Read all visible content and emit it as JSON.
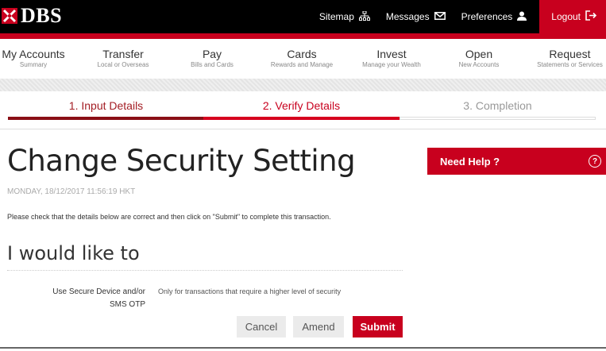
{
  "brand": {
    "name": "DBS",
    "accent": "#c8001e"
  },
  "header": {
    "links": [
      {
        "label": "Sitemap",
        "icon": "sitemap-icon"
      },
      {
        "label": "Messages",
        "icon": "envelope-icon"
      },
      {
        "label": "Preferences",
        "icon": "user-icon"
      },
      {
        "label": "Logout",
        "icon": "logout-icon"
      }
    ]
  },
  "nav": {
    "items": [
      {
        "title": "My Accounts",
        "sub": "Summary"
      },
      {
        "title": "Transfer",
        "sub": "Local or Overseas"
      },
      {
        "title": "Pay",
        "sub": "Bills and Cards"
      },
      {
        "title": "Cards",
        "sub": "Rewards and Manage"
      },
      {
        "title": "Invest",
        "sub": "Manage your Wealth"
      },
      {
        "title": "Open",
        "sub": "New Accounts"
      },
      {
        "title": "Request",
        "sub": "Statements or Services"
      }
    ]
  },
  "steps": [
    {
      "label": "1. Input Details",
      "state": "done"
    },
    {
      "label": "2. Verify Details",
      "state": "current"
    },
    {
      "label": "3. Completion",
      "state": "pending"
    }
  ],
  "main": {
    "title": "Change Security Setting",
    "timestamp": "MONDAY, 18/12/2017 11:56:19 HKT",
    "instruction": "Please check that the details below are correct and then click on \"Submit\" to complete this transaction.",
    "section_title": "I would like to",
    "field": {
      "label": "Use Secure Device and/or SMS OTP",
      "value": "Only for transactions that require a higher level of security"
    },
    "buttons": {
      "cancel": "Cancel",
      "amend": "Amend",
      "submit": "Submit"
    }
  },
  "help": {
    "label": "Need Help ?",
    "icon": "question-circle-icon",
    "glyph": "?"
  }
}
